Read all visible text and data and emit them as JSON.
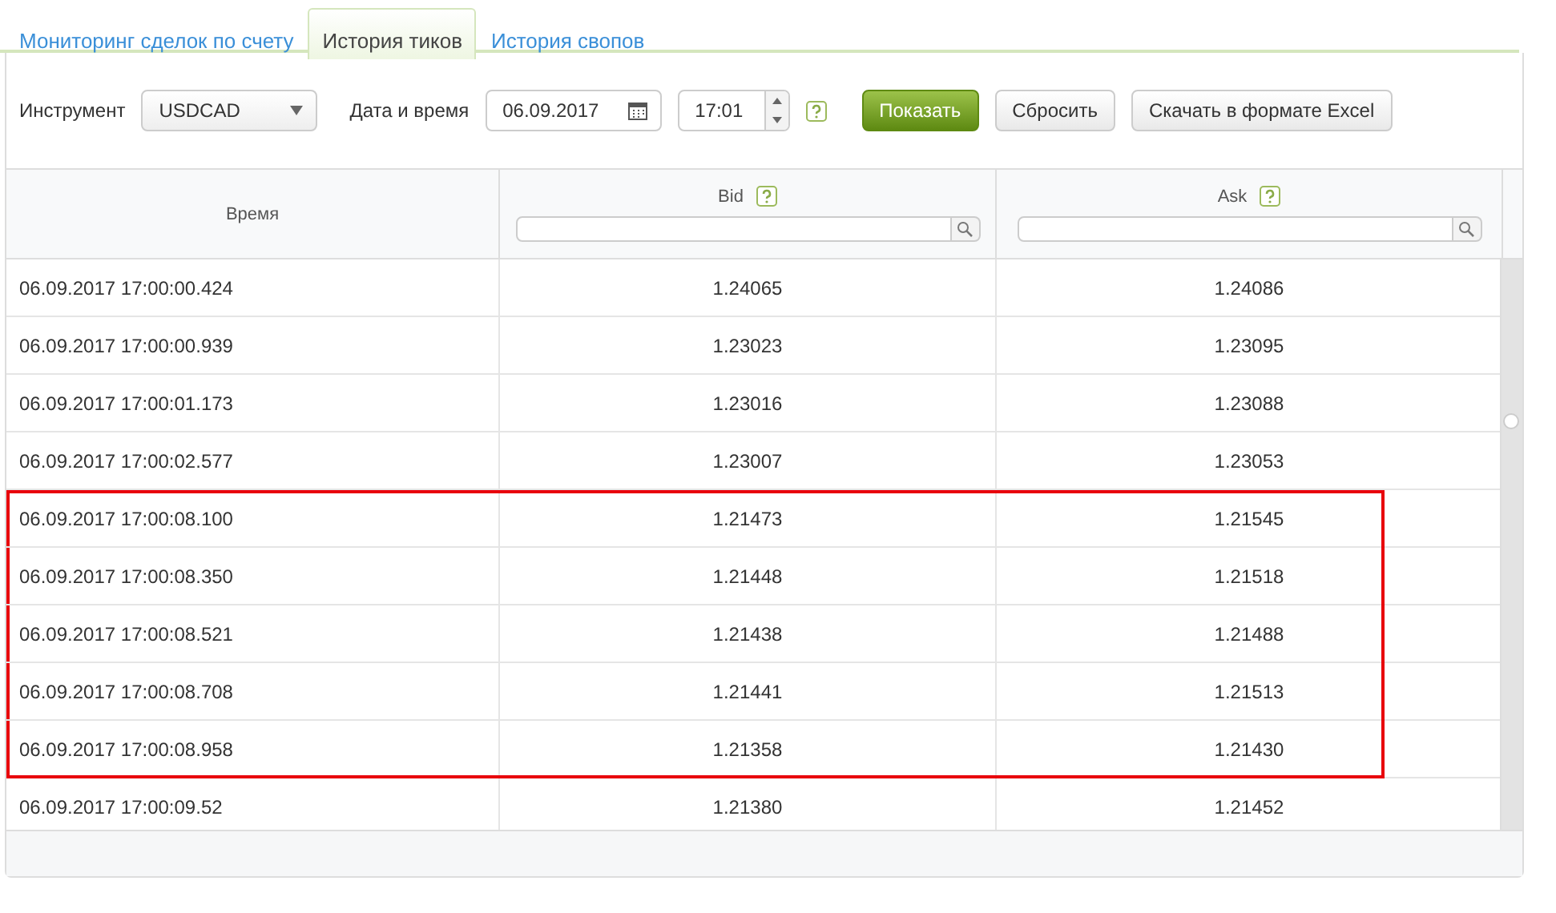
{
  "tabs": [
    {
      "label": "Мониторинг сделок по счету",
      "selected": false
    },
    {
      "label": "История тиков",
      "selected": true
    },
    {
      "label": "История свопов",
      "selected": false
    }
  ],
  "toolbar": {
    "instrument_label": "Инструмент",
    "instrument": "USDCAD",
    "datetime_label": "Дата и время",
    "date": "06.09.2017",
    "time": "17:01",
    "buttons": [
      {
        "label": "Показать",
        "kind": "primary"
      },
      {
        "label": "Сбросить",
        "kind": "default"
      },
      {
        "label": "Скачать в формате Excel",
        "kind": "default"
      }
    ]
  },
  "table": {
    "columns": [
      {
        "label": "Время",
        "help": false,
        "filter": false
      },
      {
        "label": "Bid",
        "help": true,
        "filter": true
      },
      {
        "label": "Ask",
        "help": true,
        "filter": true
      }
    ],
    "rows": [
      {
        "time": "06.09.2017 17:00:00.424",
        "bid": "1.24065",
        "ask": "1.24086",
        "highlighted": false
      },
      {
        "time": "06.09.2017 17:00:00.939",
        "bid": "1.23023",
        "ask": "1.23095",
        "highlighted": false
      },
      {
        "time": "06.09.2017 17:00:01.173",
        "bid": "1.23016",
        "ask": "1.23088",
        "highlighted": false
      },
      {
        "time": "06.09.2017 17:00:02.577",
        "bid": "1.23007",
        "ask": "1.23053",
        "highlighted": false
      },
      {
        "time": "06.09.2017 17:00:08.100",
        "bid": "1.21473",
        "ask": "1.21545",
        "highlighted": true
      },
      {
        "time": "06.09.2017 17:00:08.350",
        "bid": "1.21448",
        "ask": "1.21518",
        "highlighted": true
      },
      {
        "time": "06.09.2017 17:00:08.521",
        "bid": "1.21438",
        "ask": "1.21488",
        "highlighted": true
      },
      {
        "time": "06.09.2017 17:00:08.708",
        "bid": "1.21441",
        "ask": "1.21513",
        "highlighted": true
      },
      {
        "time": "06.09.2017 17:00:08.958",
        "bid": "1.21358",
        "ask": "1.21430",
        "highlighted": true
      },
      {
        "time": "06.09.2017 17:00:09.52",
        "bid": "1.21380",
        "ask": "1.21452",
        "highlighted": false
      }
    ]
  }
}
